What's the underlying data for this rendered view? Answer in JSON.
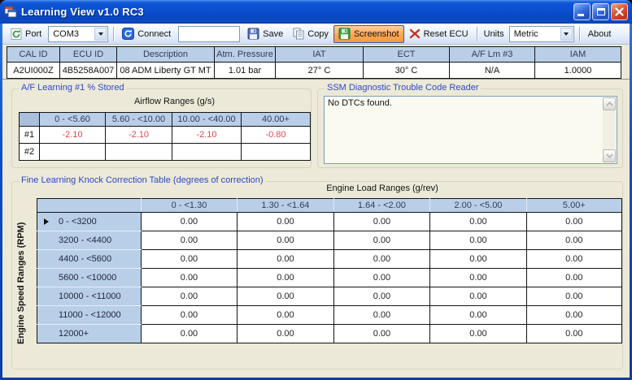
{
  "window": {
    "title": "Learning View v1.0 RC3"
  },
  "toolbar": {
    "port_label": "Port",
    "port_value": "COM3",
    "connect_label": "Connect",
    "input_value": "",
    "save_label": "Save",
    "copy_label": "Copy",
    "screenshot_label": "Screenshot",
    "reset_label": "Reset ECU",
    "units_label": "Units",
    "units_value": "Metric",
    "about_label": "About"
  },
  "info_grid": {
    "columns": [
      "CAL ID",
      "ECU ID",
      "Description",
      "Atm. Pressure",
      "IAT",
      "ECT",
      "A/F Lm #3",
      "IAM"
    ],
    "values": [
      "A2UI000Z",
      "4B5258A007",
      "08 ADM Liberty GT MT",
      "1.01 bar",
      "27° C",
      "30° C",
      "N/A",
      "1.0000"
    ]
  },
  "af_learning": {
    "group_title": "A/F Learning #1 % Stored",
    "table_title": "Airflow Ranges (g/s)",
    "columns": [
      "0 - <5.60",
      "5.60 - <10.00",
      "10.00 - <40.00",
      "40.00+"
    ],
    "rows": [
      {
        "label": "#1",
        "values": [
          "-2.10",
          "-2.10",
          "-2.10",
          "-0.80"
        ]
      },
      {
        "label": "#2",
        "values": [
          "",
          "",
          "",
          ""
        ]
      }
    ]
  },
  "dtc": {
    "group_title": "SSM Diagnostic Trouble Code Reader",
    "content": "No DTCs found."
  },
  "knock": {
    "group_title": "Fine Learning Knock Correction Table (degrees of correction)",
    "load_axis_title": "Engine Load Ranges (g/rev)",
    "speed_axis_title": "Engine Speed Ranges (RPM)",
    "columns": [
      "0 - <1.30",
      "1.30 - <1.64",
      "1.64 - <2.00",
      "2.00 - <5.00",
      "5.00+"
    ],
    "rows": [
      {
        "label": "0 - <3200",
        "selected": true,
        "values": [
          "0.00",
          "0.00",
          "0.00",
          "0.00",
          "0.00"
        ]
      },
      {
        "label": "3200 - <4400",
        "selected": false,
        "values": [
          "0.00",
          "0.00",
          "0.00",
          "0.00",
          "0.00"
        ]
      },
      {
        "label": "4400 - <5600",
        "selected": false,
        "values": [
          "0.00",
          "0.00",
          "0.00",
          "0.00",
          "0.00"
        ]
      },
      {
        "label": "5600 - <10000",
        "selected": false,
        "values": [
          "0.00",
          "0.00",
          "0.00",
          "0.00",
          "0.00"
        ]
      },
      {
        "label": "10000 - <11000",
        "selected": false,
        "values": [
          "0.00",
          "0.00",
          "0.00",
          "0.00",
          "0.00"
        ]
      },
      {
        "label": "11000 - <12000",
        "selected": false,
        "values": [
          "0.00",
          "0.00",
          "0.00",
          "0.00",
          "0.00"
        ]
      },
      {
        "label": "12000+",
        "selected": false,
        "values": [
          "0.00",
          "0.00",
          "0.00",
          "0.00",
          "0.00"
        ]
      }
    ]
  },
  "colors": {
    "af_value_color": "#e0484e",
    "titlebar_blue": "#0b4ccc",
    "header_cell_blue": "#b9cfe8",
    "screenshot_highlight": "#fca44e",
    "group_label_blue": "#2b48c8",
    "client_background": "#ece9d8"
  }
}
